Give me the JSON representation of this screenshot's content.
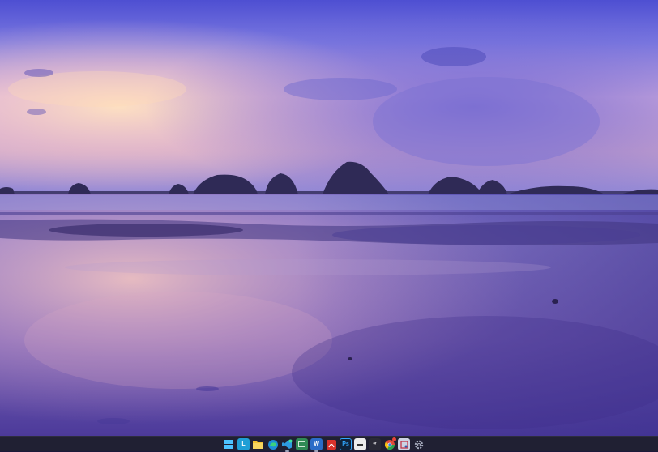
{
  "desktop": {
    "wallpaper": "sunset-beach-with-island-silhouettes"
  },
  "taskbar": {
    "background": "#202033",
    "accent": "#4cc2ff",
    "icons": [
      {
        "name": "start-button",
        "icon": "windows-logo-icon"
      },
      {
        "name": "taskbar-app-l",
        "icon": "l-app-icon",
        "glyph": "L",
        "color": "#1f9fd6"
      },
      {
        "name": "taskbar-file-explorer",
        "icon": "folder-icon",
        "color": "#f2c233"
      },
      {
        "name": "taskbar-edge",
        "icon": "edge-icon",
        "color": "#1d8ed8"
      },
      {
        "name": "taskbar-vscode-insiders",
        "icon": "vscode-icon",
        "color": "#2e9be0"
      },
      {
        "name": "taskbar-app-green",
        "icon": "green-app-icon",
        "color": "#2f8a55"
      },
      {
        "name": "taskbar-word",
        "icon": "word-icon",
        "glyph": "W",
        "color": "#2b6cc7"
      },
      {
        "name": "taskbar-acrobat",
        "icon": "acrobat-icon",
        "color": "#d8322c"
      },
      {
        "name": "taskbar-photoshop",
        "icon": "photoshop-icon",
        "glyph": "Ps",
        "color": "#0f2238"
      },
      {
        "name": "taskbar-app-white",
        "icon": "white-app-icon",
        "color": "#ececec"
      },
      {
        "name": "taskbar-app-dark",
        "icon": "dark-app-icon",
        "glyph": "ᵒʳ",
        "color": "#2a2a36"
      },
      {
        "name": "taskbar-chrome",
        "icon": "chrome-icon",
        "color": "#e9e9e9"
      },
      {
        "name": "taskbar-snipping",
        "icon": "snipping-tool-icon",
        "color": "#cdd3e3"
      },
      {
        "name": "taskbar-settings",
        "icon": "settings-gear-icon",
        "color": "#9aa0b0"
      }
    ]
  }
}
